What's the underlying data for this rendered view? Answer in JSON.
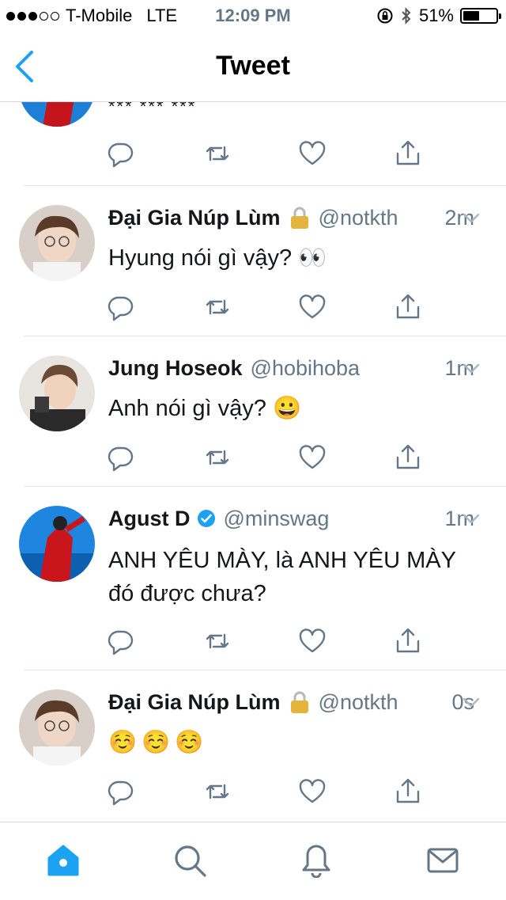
{
  "status_bar": {
    "carrier": "T-Mobile",
    "network": "LTE",
    "time": "12:09 PM",
    "battery": "51%",
    "battery_level": 0.51,
    "signal_bars_filled": 3,
    "signal_bars_total": 5
  },
  "nav": {
    "title": "Tweet"
  },
  "colors": {
    "accent": "#1da1f2",
    "icon": "#657786",
    "text": "#14171a"
  },
  "partial_tweet": {
    "text": "*** *** ***"
  },
  "tweets": [
    {
      "name": "Đại Gia Núp Lùm",
      "handle": "@notkth",
      "time": "2m",
      "text": "Hyung nói gì vậy? 👀",
      "locked": true,
      "verified": false
    },
    {
      "name": "Jung Hoseok",
      "handle": "@hobihoba",
      "time": "1m",
      "text": "Anh nói gì vậy? 😀",
      "locked": false,
      "verified": false
    },
    {
      "name": "Agust D",
      "handle": "@minswag",
      "time": "1m",
      "text": "ANH YÊU MÀY, là ANH YÊU MÀY đó được chưa?",
      "locked": false,
      "verified": true
    },
    {
      "name": "Đại Gia Núp Lùm",
      "handle": "@notkth",
      "time": "0s",
      "text": "☺️☺️☺️",
      "locked": true,
      "verified": false
    }
  ],
  "tabs": [
    {
      "icon": "home-icon",
      "active": true
    },
    {
      "icon": "search-icon",
      "active": false
    },
    {
      "icon": "notifications-icon",
      "active": false
    },
    {
      "icon": "messages-icon",
      "active": false
    }
  ]
}
